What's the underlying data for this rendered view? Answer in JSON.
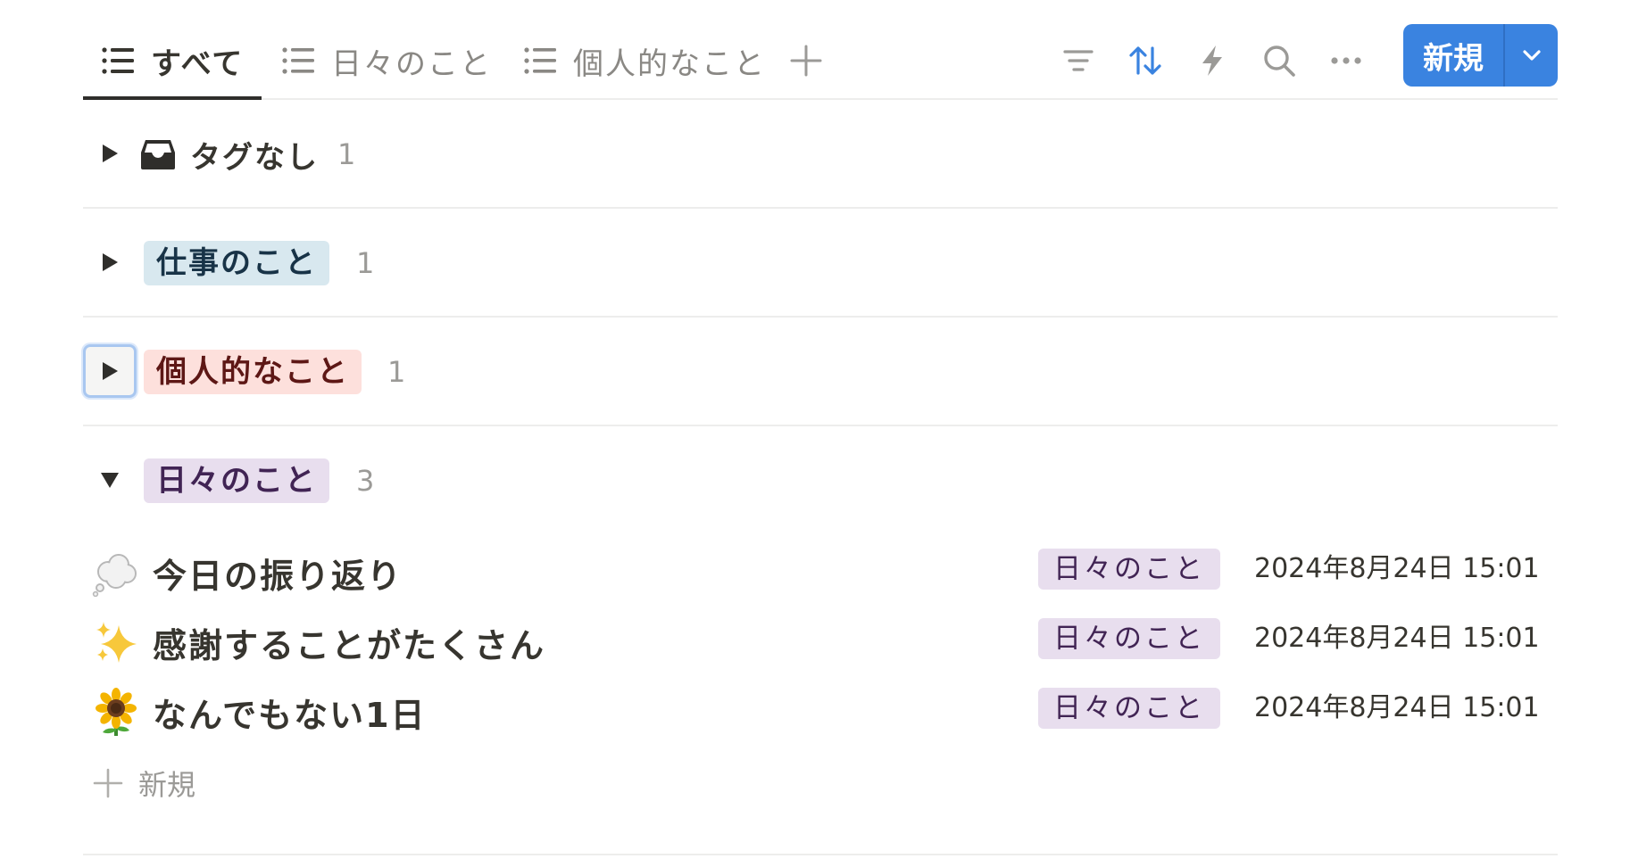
{
  "tabs": [
    {
      "label": "すべて",
      "icon": "list-icon",
      "active": true
    },
    {
      "label": "日々のこと",
      "icon": "list-icon",
      "active": false
    },
    {
      "label": "個人的なこと",
      "icon": "list-icon",
      "active": false
    }
  ],
  "toolbar": {
    "icons": [
      "filter-icon",
      "sort-icon",
      "automation-icon",
      "search-icon",
      "more-icon"
    ],
    "accent": "#3a83e0",
    "new_label": "新規"
  },
  "groups": [
    {
      "label": "タグなし",
      "count": "1",
      "expanded": false,
      "icon": "inbox-icon",
      "tag_bg": null,
      "tag_fg": null
    },
    {
      "label": "仕事のこと",
      "count": "1",
      "expanded": false,
      "icon": null,
      "tag_bg": "#d8e8ef",
      "tag_fg": "#183347"
    },
    {
      "label": "個人的なこと",
      "count": "1",
      "expanded": false,
      "focused": true,
      "icon": null,
      "tag_bg": "#fde0dc",
      "tag_fg": "#5d1715"
    },
    {
      "label": "日々のこと",
      "count": "3",
      "expanded": true,
      "icon": null,
      "tag_bg": "#e8deee",
      "tag_fg": "#412454"
    }
  ],
  "items": [
    {
      "emoji": "thought-cloud-icon",
      "title": "今日の振り返り",
      "tag": "日々のこと",
      "date": "2024年8月24日 15:01"
    },
    {
      "emoji": "sparkles-icon",
      "title": "感謝することがたくさん",
      "tag": "日々のこと",
      "date": "2024年8月24日 15:01"
    },
    {
      "emoji": "sunflower-icon",
      "title": "なんでもない1日",
      "tag": "日々のこと",
      "date": "2024年8月24日 15:01"
    }
  ],
  "new_row_label": "新規"
}
